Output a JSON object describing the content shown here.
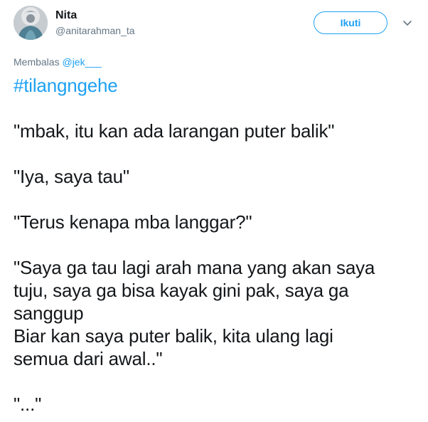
{
  "tweet": {
    "author": {
      "display_name": "Nita",
      "handle": "@anitarahman_ta",
      "avatar": "avatar-photo"
    },
    "follow_label": "Ikuti",
    "menu_icon": "chevron-down-icon",
    "reply_prefix": "Membalas",
    "reply_mention": "@jek___",
    "hashtag": "#tilangngehe",
    "paragraphs": [
      "\"mbak, itu kan ada larangan puter balik\"",
      "\"Iya, saya tau\"",
      "\"Terus kenapa mba langgar?\"",
      "\"Saya ga tau lagi arah mana yang akan saya\ntuju, saya ga bisa kayak gini pak, saya ga\nsanggup\nBiar kan saya puter balik, kita ulang lagi\nsemua dari awal..\"",
      "\"...\""
    ]
  },
  "colors": {
    "accent": "#1da1f2",
    "text": "#14171a",
    "muted": "#657786"
  }
}
